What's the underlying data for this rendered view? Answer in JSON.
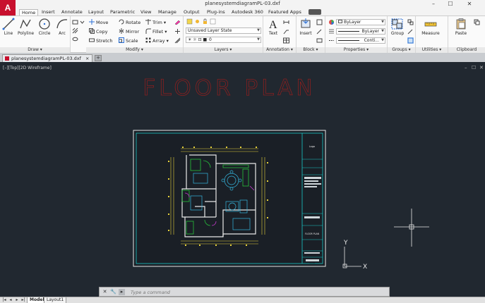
{
  "app": {
    "logo_letter": "A",
    "document_title": "planesystemdiagramPL-03.dxf",
    "window_controls": [
      "–",
      "☐",
      "✕"
    ]
  },
  "ribbon_tabs": [
    "Home",
    "Insert",
    "Annotate",
    "Layout",
    "Parametric",
    "View",
    "Manage",
    "Output",
    "Plug-ins",
    "Autodesk 360",
    "Featured Apps"
  ],
  "ribbon": {
    "draw": {
      "label": "Draw ▾",
      "tools": [
        "Line",
        "Polyline",
        "Circle",
        "Arc"
      ]
    },
    "modify": {
      "label": "Modify ▾",
      "tools": [
        "Move",
        "Rotate",
        "Trim ▾",
        "Copy",
        "Mirror",
        "Fillet ▾",
        "Stretch",
        "Scale",
        "Array ▾"
      ]
    },
    "layers": {
      "label": "Layers ▾",
      "layer_state": "Unsaved Layer State",
      "current_layer": "0"
    },
    "annotation": {
      "label": "Annotation ▾",
      "text_tool": "Text"
    },
    "block": {
      "label": "Block ▾",
      "insert_tool": "Insert"
    },
    "properties": {
      "label": "Properties ▾",
      "color": "ByLayer",
      "linetype": "ByLayer",
      "lineweight": "Conti..."
    },
    "groups": {
      "label": "Groups ▾",
      "tool": "Group"
    },
    "utilities": {
      "label": "Utilities ▾",
      "tool": "Measure"
    },
    "clipboard": {
      "label": "Clipboard",
      "tool": "Paste"
    }
  },
  "file_tab": {
    "name": "planesystemdiagramPL-03.dxf",
    "close": "×",
    "new_tab": "+"
  },
  "viewport": {
    "label": "[–][Top][2D Wireframe]",
    "controls": [
      "–",
      "☐",
      "✕"
    ],
    "drawing_title": "FLOOR PLAN",
    "title_block": {
      "logo_text": "Logo",
      "sheet_title": "FLOOR PLAN",
      "sheet_number": "PL-03"
    },
    "ucs": {
      "x_label": "X",
      "y_label": "Y"
    }
  },
  "command_line": {
    "placeholder": "Type a command"
  },
  "layout_tabs": [
    "Model",
    "Layout1"
  ],
  "colors": {
    "canvas": "#212830",
    "title_red": "#8c1f1f",
    "sheet_border": "#e8e8e8",
    "frame_cyan": "#19c7c7",
    "dim_yellow": "#e7d23a",
    "room_green": "#27c13b",
    "furniture_cyan": "#35b8e0",
    "magenta": "#c83ad0"
  }
}
